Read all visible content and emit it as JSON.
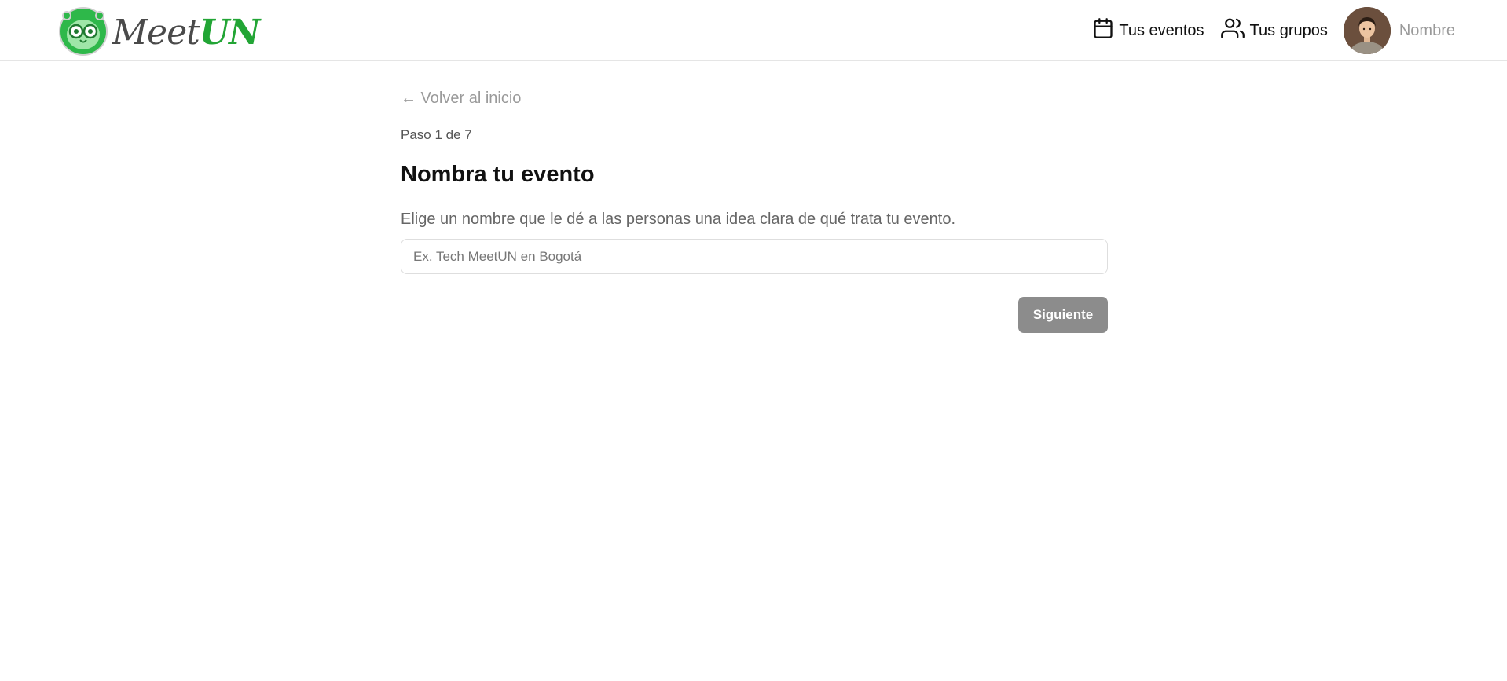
{
  "header": {
    "logo": {
      "text_meet": "Meet",
      "text_un": "UN",
      "icon": "owl-logo-icon",
      "brand_green": "#22a535"
    },
    "nav": {
      "events_label": "Tus eventos",
      "events_icon": "calendar-icon",
      "groups_label": "Tus grupos",
      "groups_icon": "users-icon"
    },
    "user": {
      "avatar": "avatar",
      "name": "Nombre"
    }
  },
  "main": {
    "back_link": "← Volver al inicio",
    "step_text": "Paso 1 de 7",
    "title": "Nombra tu evento",
    "description": "Elige un nombre que le dé a las personas una idea clara de qué trata tu evento.",
    "name_input": {
      "value": "",
      "placeholder": "Ex. Tech MeetUN en Bogotá"
    },
    "next_button": "Siguiente"
  }
}
